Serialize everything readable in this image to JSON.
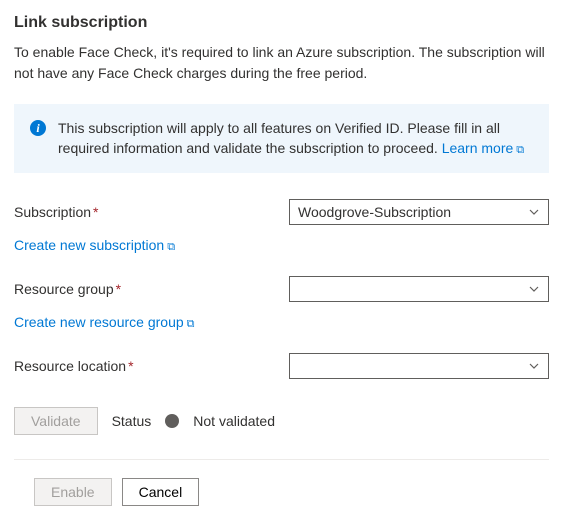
{
  "header": {
    "title": "Link subscription"
  },
  "intro": "To enable Face Check, it's required to link an Azure subscription. The subscription will not have any Face Check charges during the free period.",
  "infobox": {
    "icon": "info-icon",
    "message": "This subscription will apply to all features on Verified ID. Please fill in all required information and validate the subscription to proceed. ",
    "learn_more": "Learn more"
  },
  "form": {
    "subscription": {
      "label": "Subscription",
      "required": true,
      "value": "Woodgrove-Subscription",
      "create_link": "Create new subscription"
    },
    "resource_group": {
      "label": "Resource group",
      "required": true,
      "value": "",
      "create_link": "Create new resource group"
    },
    "resource_location": {
      "label": "Resource location",
      "required": true,
      "value": ""
    }
  },
  "validate": {
    "button": "Validate",
    "status_label": "Status",
    "status_value": "Not validated"
  },
  "actions": {
    "enable": "Enable",
    "cancel": "Cancel"
  },
  "colors": {
    "link": "#0078d4",
    "infobox_bg": "#eff6fc",
    "required": "#a4262c"
  }
}
